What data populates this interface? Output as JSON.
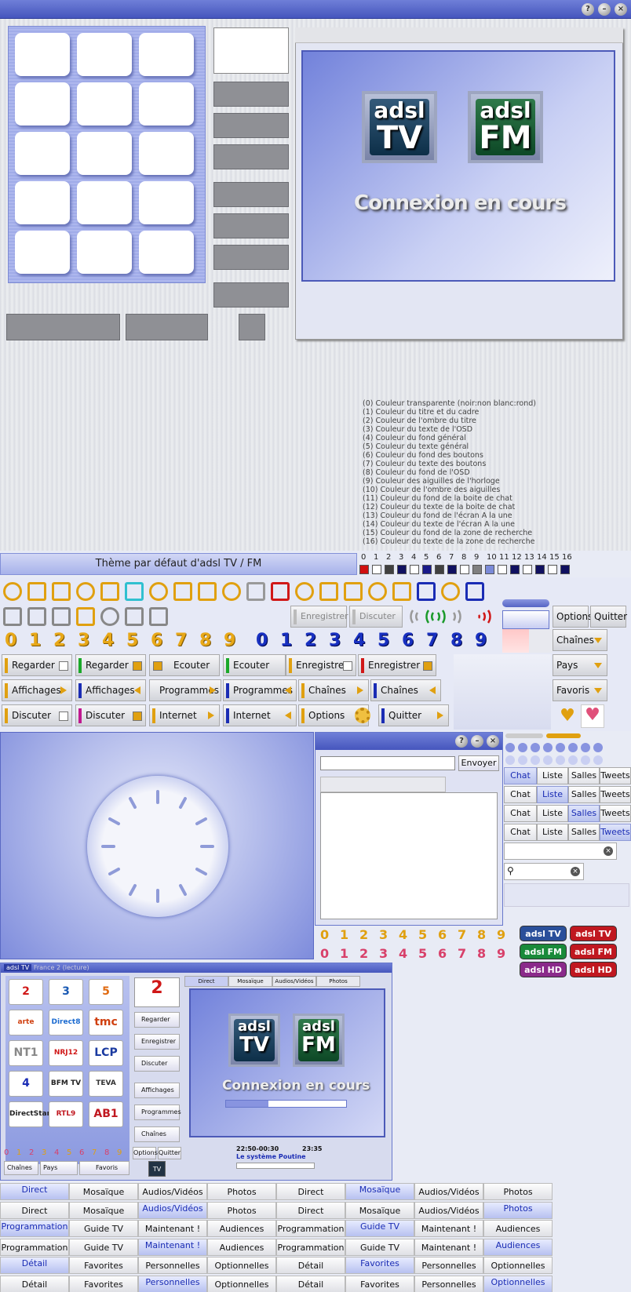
{
  "window": {
    "help": "?",
    "minimize": "–",
    "close": "×"
  },
  "legend": {
    "lines": [
      "(0) Couleur transparente (noir:non blanc:rond)",
      "(1) Couleur du titre et du cadre",
      "(2) Couleur de l'ombre du titre",
      "(3) Couleur du texte de l'OSD",
      "(4) Couleur du fond général",
      "(5) Couleur du texte général",
      "(6) Couleur du fond des boutons",
      "(7) Couleur du texte des boutons",
      "(8) Couleur du fond de l'OSD",
      "(9) Couleur des aiguilles de l'horloge",
      "(10) Couleur de l'ombre des aiguilles",
      "(11) Couleur du fond de la boite de chat",
      "(12) Couleur du texte de la boite de chat",
      "(13) Couleur du fond de l'écran A la une",
      "(14) Couleur du texte de l'écran A la une",
      "(15) Couleur du fond de la zone de recherche",
      "(16) Couleur du texte de la zone de recherche"
    ]
  },
  "screen": {
    "logo_tv_top": "adsl",
    "logo_tv_bottom": "TV",
    "logo_fm_top": "adsl",
    "logo_fm_bottom": "FM",
    "status": "Connexion en cours"
  },
  "theme": {
    "title": "Thème par défaut d'adsl TV / FM",
    "numbers": [
      "0",
      "1",
      "2",
      "3",
      "4",
      "5",
      "6",
      "7",
      "8",
      "9",
      "10",
      "11",
      "12",
      "13",
      "14",
      "15",
      "16"
    ],
    "swatches": [
      "#d01010",
      "#ffffff",
      "#404040",
      "#101060",
      "#ffffff",
      "#1a1a8a",
      "#404040",
      "#101060",
      "#ffffff",
      "#808080",
      "#7a8ad8",
      "#ffffff",
      "#101060",
      "#ffffff",
      "#101060",
      "#ffffff",
      "#101060"
    ]
  },
  "toolbar": {
    "record": "Enregistrer",
    "discuss": "Discuter",
    "options": "Options",
    "quit": "Quitter"
  },
  "digits": [
    "0",
    "1",
    "2",
    "3",
    "4",
    "5",
    "6",
    "7",
    "8",
    "9"
  ],
  "buttons": {
    "regarder": "Regarder",
    "ecouter": "Ecouter",
    "enregistrer": "Enregistrer",
    "affichages": "Affichages",
    "programmes": "Programmes",
    "chaines": "Chaînes",
    "discuter": "Discuter",
    "internet": "Internet",
    "options": "Options",
    "quitter": "Quitter",
    "pays": "Pays",
    "favoris": "Favoris"
  },
  "chat": {
    "send": "Envoyer",
    "tabs": [
      "Chat",
      "Liste",
      "Salles",
      "Tweets"
    ]
  },
  "brands": {
    "tv": "adsl TV",
    "fm": "adsl FM",
    "hd": "adsl HD"
  },
  "mini": {
    "title": "adsl TV",
    "subtitle": "France 2 (lecture)",
    "tabs": [
      "Direct",
      "Mosaïque",
      "Audios/Vidéos",
      "Photos"
    ],
    "channels": [
      "2",
      "3",
      "5",
      "arte",
      "Direct8",
      "tmc",
      "NT1",
      "NRJ12",
      "LCP",
      "4",
      "BFM TV",
      "TEVA",
      "DirectStar",
      "RTL9",
      "AB1"
    ],
    "side": [
      "Regarder",
      "Enregistrer",
      "Discuter",
      "Affichages",
      "Programmes",
      "Chaînes"
    ],
    "bottom": [
      "Options",
      "Quitter"
    ],
    "selects": [
      "Chaînes",
      "Pays",
      "Favoris"
    ],
    "time": "22:50-00:30",
    "time2": "23:35",
    "show": "Le système Poutine",
    "logo_badge": "TV"
  },
  "nav": {
    "row1": [
      "Direct",
      "Mosaïque",
      "Audios/Vidéos",
      "Photos",
      "Direct",
      "Mosaïque",
      "Audios/Vidéos",
      "Photos"
    ],
    "row2": [
      "Direct",
      "Mosaïque",
      "Audios/Vidéos",
      "Photos",
      "Direct",
      "Mosaïque",
      "Audios/Vidéos",
      "Photos"
    ],
    "row3": [
      "Programmation",
      "Guide TV",
      "Maintenant !",
      "Audiences",
      "Programmation",
      "Guide TV",
      "Maintenant !",
      "Audiences"
    ],
    "row4": [
      "Programmation",
      "Guide TV",
      "Maintenant !",
      "Audiences",
      "Programmation",
      "Guide TV",
      "Maintenant !",
      "Audiences"
    ],
    "row5": [
      "Détail",
      "Favorites",
      "Personnelles",
      "Optionnelles",
      "Détail",
      "Favorites",
      "Personnelles",
      "Optionnelles"
    ],
    "row6": [
      "Détail",
      "Favorites",
      "Personnelles",
      "Optionnelles",
      "Détail",
      "Favorites",
      "Personnelles",
      "Optionnelles"
    ]
  }
}
